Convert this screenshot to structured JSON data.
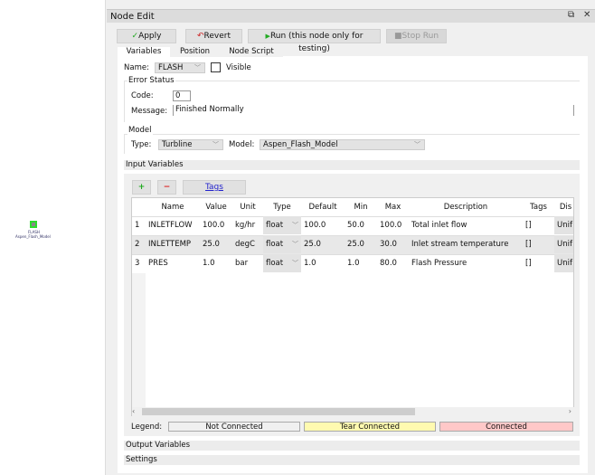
{
  "canvas": {
    "node": {
      "name": "FLASH",
      "model": "Aspen_Flash_Model"
    }
  },
  "window": {
    "title": "Node Edit",
    "float_icon": "restore-icon",
    "close_icon": "close-icon"
  },
  "toolbar": {
    "apply": "Apply",
    "revert": "Revert",
    "run": "Run (this node only for testing)",
    "stop": "Stop Run"
  },
  "tabs": [
    "Variables",
    "Position",
    "Node Script"
  ],
  "name_row": {
    "label": "Name:",
    "value": "FLASH",
    "visible_label": "Visible",
    "visible_checked": false
  },
  "error_status": {
    "title": "Error Status",
    "code_label": "Code:",
    "code": "0",
    "message_label": "Message:",
    "message": "Finished Normally"
  },
  "model": {
    "title": "Model",
    "type_label": "Type:",
    "type": "Turbline",
    "model_label": "Model:",
    "model": "Aspen_Flash_Model"
  },
  "input_variables": {
    "title": "Input Variables",
    "add": "+",
    "remove": "−",
    "tags_button": "Tags",
    "columns": [
      "",
      "Name",
      "Value",
      "Unit",
      "Type",
      "Default",
      "Min",
      "Max",
      "Description",
      "Tags",
      "Dis"
    ],
    "rows": [
      [
        "1",
        "INLETFLOW",
        "100.0",
        "kg/hr",
        "float",
        "100.0",
        "50.0",
        "100.0",
        "Total inlet flow",
        "[]",
        "Unif"
      ],
      [
        "2",
        "INLETTEMP",
        "25.0",
        "degC",
        "float",
        "25.0",
        "25.0",
        "30.0",
        "Inlet stream temperature",
        "[]",
        "Unif"
      ],
      [
        "3",
        "PRES",
        "1.0",
        "bar",
        "float",
        "1.0",
        "1.0",
        "80.0",
        "Flash Pressure",
        "[]",
        "Unif"
      ]
    ],
    "legend_label": "Legend:",
    "legend": [
      {
        "label": "Not Connected",
        "color": "#ffffff"
      },
      {
        "label": "Tear Connected",
        "color": "#fffab0"
      },
      {
        "label": "Connected",
        "color": "#ffc8c8"
      }
    ]
  },
  "output_variables": {
    "title": "Output Variables"
  },
  "settings": {
    "title": "Settings"
  }
}
